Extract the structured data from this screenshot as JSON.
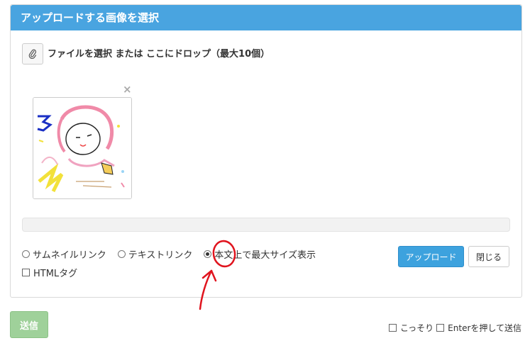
{
  "panel": {
    "title": "アップロードする画像を選択"
  },
  "uploader": {
    "drop_label": "ファイルを選択 または ここにドロップ（最大10個）"
  },
  "thumbnail": {
    "remove_label": "×"
  },
  "options": {
    "radios": [
      {
        "label": "サムネイルリンク",
        "checked": false
      },
      {
        "label": "テキストリンク",
        "checked": false
      },
      {
        "label": "本文上で最大サイズ表示",
        "checked": true
      }
    ],
    "html_tag_label": "HTMLタグ"
  },
  "buttons": {
    "upload": "アップロード",
    "close": "閉じる",
    "send": "送信"
  },
  "footer": {
    "secret_label": "こっそり",
    "enter_send_label": "Enterを押して送信"
  },
  "colors": {
    "header": "#49a4e0",
    "upload_button": "#3da2de",
    "send_button": "#9fd19a",
    "annotation": "#e0141e"
  },
  "icons": {
    "attach": "paperclip-icon"
  }
}
